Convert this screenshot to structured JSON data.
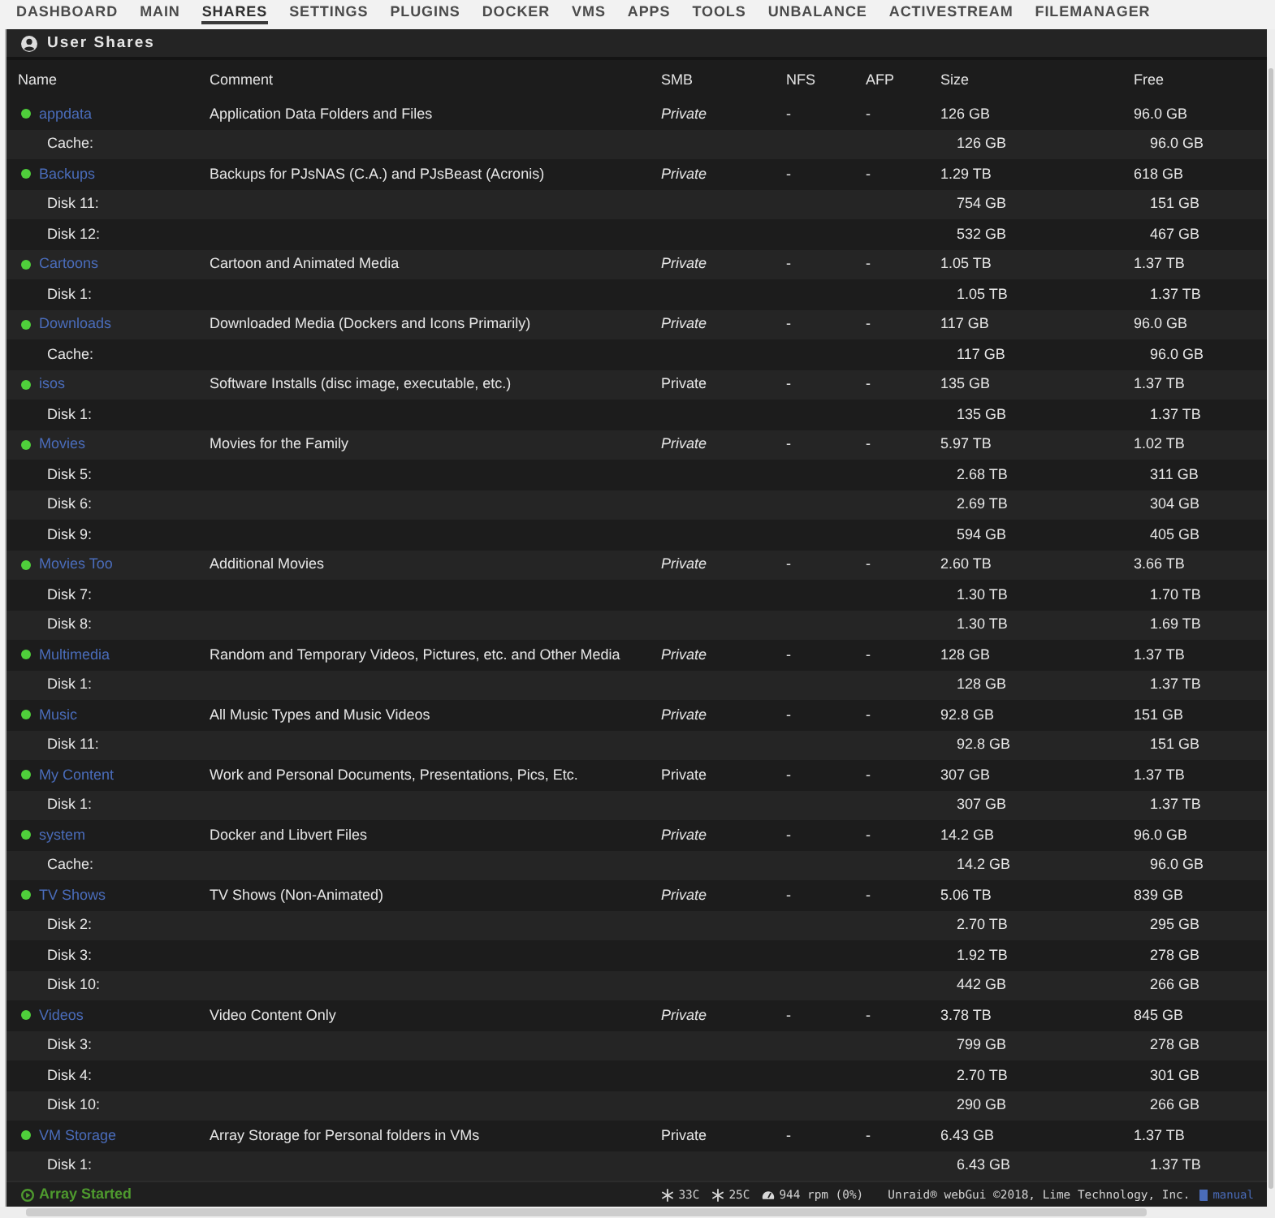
{
  "nav": {
    "tabs": [
      {
        "label": "DASHBOARD",
        "selected": false
      },
      {
        "label": "MAIN",
        "selected": false
      },
      {
        "label": "SHARES",
        "selected": true
      },
      {
        "label": "SETTINGS",
        "selected": false
      },
      {
        "label": "PLUGINS",
        "selected": false
      },
      {
        "label": "DOCKER",
        "selected": false
      },
      {
        "label": "VMS",
        "selected": false
      },
      {
        "label": "APPS",
        "selected": false
      },
      {
        "label": "TOOLS",
        "selected": false
      },
      {
        "label": "UNBALANCE",
        "selected": false
      },
      {
        "label": "ACTIVESTREAM",
        "selected": false
      },
      {
        "label": "FILEMANAGER",
        "selected": false
      }
    ]
  },
  "panel": {
    "title": "User Shares"
  },
  "table": {
    "columns": [
      "Name",
      "Comment",
      "SMB",
      "NFS",
      "AFP",
      "Size",
      "Free"
    ],
    "shares": [
      {
        "name": "appdata",
        "comment": "Application Data Folders and Files",
        "smb": "Private",
        "smb_hidden": true,
        "nfs": "-",
        "afp": "-",
        "size": "126 GB",
        "free": "96.0 GB",
        "disks": [
          {
            "label": "Cache:",
            "size": "126 GB",
            "free": "96.0 GB"
          }
        ]
      },
      {
        "name": "Backups",
        "comment": "Backups for PJsNAS (C.A.) and PJsBeast (Acronis)",
        "smb": "Private",
        "smb_hidden": true,
        "nfs": "-",
        "afp": "-",
        "size": "1.29 TB",
        "free": "618 GB",
        "disks": [
          {
            "label": "Disk 11:",
            "size": "754 GB",
            "free": "151 GB"
          },
          {
            "label": "Disk 12:",
            "size": "532 GB",
            "free": "467 GB"
          }
        ]
      },
      {
        "name": "Cartoons",
        "comment": "Cartoon and Animated Media",
        "smb": "Private",
        "smb_hidden": true,
        "nfs": "-",
        "afp": "-",
        "size": "1.05 TB",
        "free": "1.37 TB",
        "disks": [
          {
            "label": "Disk 1:",
            "size": "1.05 TB",
            "free": "1.37 TB"
          }
        ]
      },
      {
        "name": "Downloads",
        "comment": "Downloaded Media (Dockers and Icons Primarily)",
        "smb": "Private",
        "smb_hidden": true,
        "nfs": "-",
        "afp": "-",
        "size": "117 GB",
        "free": "96.0 GB",
        "disks": [
          {
            "label": "Cache:",
            "size": "117 GB",
            "free": "96.0 GB"
          }
        ]
      },
      {
        "name": "isos",
        "comment": "Software Installs (disc image, executable, etc.)",
        "smb": "Private",
        "smb_hidden": false,
        "nfs": "-",
        "afp": "-",
        "size": "135 GB",
        "free": "1.37 TB",
        "disks": [
          {
            "label": "Disk 1:",
            "size": "135 GB",
            "free": "1.37 TB"
          }
        ]
      },
      {
        "name": "Movies",
        "comment": "Movies for the Family",
        "smb": "Private",
        "smb_hidden": true,
        "nfs": "-",
        "afp": "-",
        "size": "5.97 TB",
        "free": "1.02 TB",
        "disks": [
          {
            "label": "Disk 5:",
            "size": "2.68 TB",
            "free": "311 GB"
          },
          {
            "label": "Disk 6:",
            "size": "2.69 TB",
            "free": "304 GB"
          },
          {
            "label": "Disk 9:",
            "size": "594 GB",
            "free": "405 GB"
          }
        ]
      },
      {
        "name": "Movies Too",
        "comment": "Additional Movies",
        "smb": "Private",
        "smb_hidden": true,
        "nfs": "-",
        "afp": "-",
        "size": "2.60 TB",
        "free": "3.66 TB",
        "disks": [
          {
            "label": "Disk 7:",
            "size": "1.30 TB",
            "free": "1.70 TB"
          },
          {
            "label": "Disk 8:",
            "size": "1.30 TB",
            "free": "1.69 TB"
          }
        ]
      },
      {
        "name": "Multimedia",
        "comment": "Random and Temporary Videos, Pictures, etc. and Other Media",
        "smb": "Private",
        "smb_hidden": true,
        "nfs": "-",
        "afp": "-",
        "size": "128 GB",
        "free": "1.37 TB",
        "disks": [
          {
            "label": "Disk 1:",
            "size": "128 GB",
            "free": "1.37 TB"
          }
        ]
      },
      {
        "name": "Music",
        "comment": "All Music Types and Music Videos",
        "smb": "Private",
        "smb_hidden": true,
        "nfs": "-",
        "afp": "-",
        "size": "92.8 GB",
        "free": "151 GB",
        "disks": [
          {
            "label": "Disk 11:",
            "size": "92.8 GB",
            "free": "151 GB"
          }
        ]
      },
      {
        "name": "My Content",
        "comment": "Work and Personal Documents, Presentations, Pics, Etc.",
        "smb": "Private",
        "smb_hidden": false,
        "nfs": "-",
        "afp": "-",
        "size": "307 GB",
        "free": "1.37 TB",
        "disks": [
          {
            "label": "Disk 1:",
            "size": "307 GB",
            "free": "1.37 TB"
          }
        ]
      },
      {
        "name": "system",
        "comment": "Docker and Libvert Files",
        "smb": "Private",
        "smb_hidden": true,
        "nfs": "-",
        "afp": "-",
        "size": "14.2 GB",
        "free": "96.0 GB",
        "disks": [
          {
            "label": "Cache:",
            "size": "14.2 GB",
            "free": "96.0 GB"
          }
        ]
      },
      {
        "name": "TV Shows",
        "comment": "TV Shows (Non-Animated)",
        "smb": "Private",
        "smb_hidden": true,
        "nfs": "-",
        "afp": "-",
        "size": "5.06 TB",
        "free": "839 GB",
        "disks": [
          {
            "label": "Disk 2:",
            "size": "2.70 TB",
            "free": "295 GB"
          },
          {
            "label": "Disk 3:",
            "size": "1.92 TB",
            "free": "278 GB"
          },
          {
            "label": "Disk 10:",
            "size": "442 GB",
            "free": "266 GB"
          }
        ]
      },
      {
        "name": "Videos",
        "comment": "Video Content Only",
        "smb": "Private",
        "smb_hidden": true,
        "nfs": "-",
        "afp": "-",
        "size": "3.78 TB",
        "free": "845 GB",
        "disks": [
          {
            "label": "Disk 3:",
            "size": "799 GB",
            "free": "278 GB"
          },
          {
            "label": "Disk 4:",
            "size": "2.70 TB",
            "free": "301 GB"
          },
          {
            "label": "Disk 10:",
            "size": "290 GB",
            "free": "266 GB"
          }
        ]
      },
      {
        "name": "VM Storage",
        "comment": "Array Storage for Personal folders in VMs",
        "smb": "Private",
        "smb_hidden": false,
        "nfs": "-",
        "afp": "-",
        "size": "6.43 GB",
        "free": "1.37 TB",
        "disks": [
          {
            "label": "Disk 1:",
            "size": "6.43 GB",
            "free": "1.37 TB"
          }
        ]
      }
    ]
  },
  "status_bar": {
    "array_status": "Array Started",
    "temperatures": [
      "33C",
      "25C"
    ],
    "fan": "944 rpm (0%)",
    "copyright": "Unraid® webGui ©2018, Lime Technology, Inc.",
    "manual_link": "manual"
  }
}
